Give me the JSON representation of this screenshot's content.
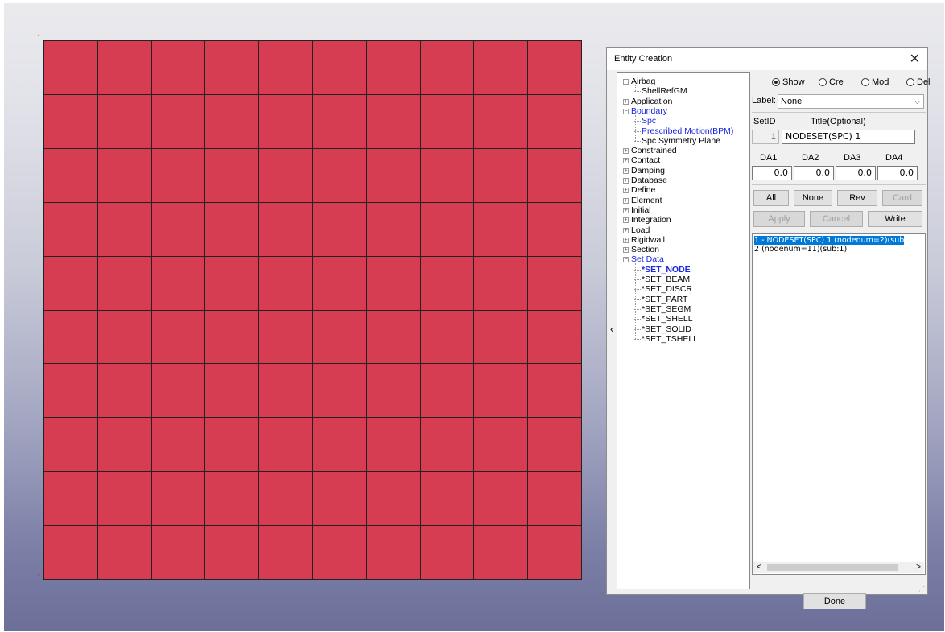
{
  "dialog": {
    "title": "Entity Creation",
    "close_glyph": "✕",
    "collapse_glyph": "‹"
  },
  "tree": {
    "items": [
      {
        "label": "Airbag",
        "exp": "minus"
      },
      {
        "label": "ShellRefGM",
        "child": true
      },
      {
        "label": "Application",
        "exp": "plus"
      },
      {
        "label": "Boundary",
        "exp": "minus",
        "blue": true
      },
      {
        "label": "Spc",
        "child": true,
        "blue": true
      },
      {
        "label": "Prescribed Motion(BPM)",
        "child": true,
        "blue": true
      },
      {
        "label": "Spc Symmetry Plane",
        "child": true
      },
      {
        "label": "Constrained",
        "exp": "plus"
      },
      {
        "label": "Contact",
        "exp": "plus"
      },
      {
        "label": "Damping",
        "exp": "plus"
      },
      {
        "label": "Database",
        "exp": "plus"
      },
      {
        "label": "Define",
        "exp": "plus"
      },
      {
        "label": "Element",
        "exp": "plus"
      },
      {
        "label": "Initial",
        "exp": "plus"
      },
      {
        "label": "Integration",
        "exp": "plus"
      },
      {
        "label": "Load",
        "exp": "plus"
      },
      {
        "label": "Rigidwall",
        "exp": "plus"
      },
      {
        "label": "Section",
        "exp": "plus"
      },
      {
        "label": "Set Data",
        "exp": "minus",
        "blue": true
      },
      {
        "label": "*SET_NODE",
        "child": true,
        "selected": true
      },
      {
        "label": "*SET_BEAM",
        "child": true
      },
      {
        "label": "*SET_DISCR",
        "child": true
      },
      {
        "label": "*SET_PART",
        "child": true
      },
      {
        "label": "*SET_SEGM",
        "child": true
      },
      {
        "label": "*SET_SHELL",
        "child": true
      },
      {
        "label": "*SET_SOLID",
        "child": true
      },
      {
        "label": "*SET_TSHELL",
        "child": true
      }
    ]
  },
  "mode": {
    "options": [
      "Show",
      "Cre",
      "Mod",
      "Del"
    ],
    "selected": "Show"
  },
  "label_field": {
    "caption": "Label:",
    "value": "None",
    "chevron": "⌵"
  },
  "setid": {
    "caption": "SetID",
    "value": "1"
  },
  "title_field": {
    "caption": "Title(Optional)",
    "value": "NODESET(SPC) 1"
  },
  "da": {
    "captions": [
      "DA1",
      "DA2",
      "DA3",
      "DA4"
    ],
    "values": [
      "0.0",
      "0.0",
      "0.0",
      "0.0"
    ]
  },
  "buttons": {
    "all": "All",
    "none": "None",
    "rev": "Rev",
    "card": "Card",
    "apply": "Apply",
    "cancel": "Cancel",
    "write": "Write",
    "done": "Done"
  },
  "list": {
    "rows": [
      "1 - NODESET(SPC) 1 (nodenum=2)(sub",
      "2 (nodenum=11)(sub:1)"
    ],
    "selected_index": 0
  },
  "scroll": {
    "left": "<",
    "right": ">"
  },
  "viewport": {
    "mesh_color": "#d73d52",
    "mesh_cols": 10,
    "mesh_rows": 10
  }
}
